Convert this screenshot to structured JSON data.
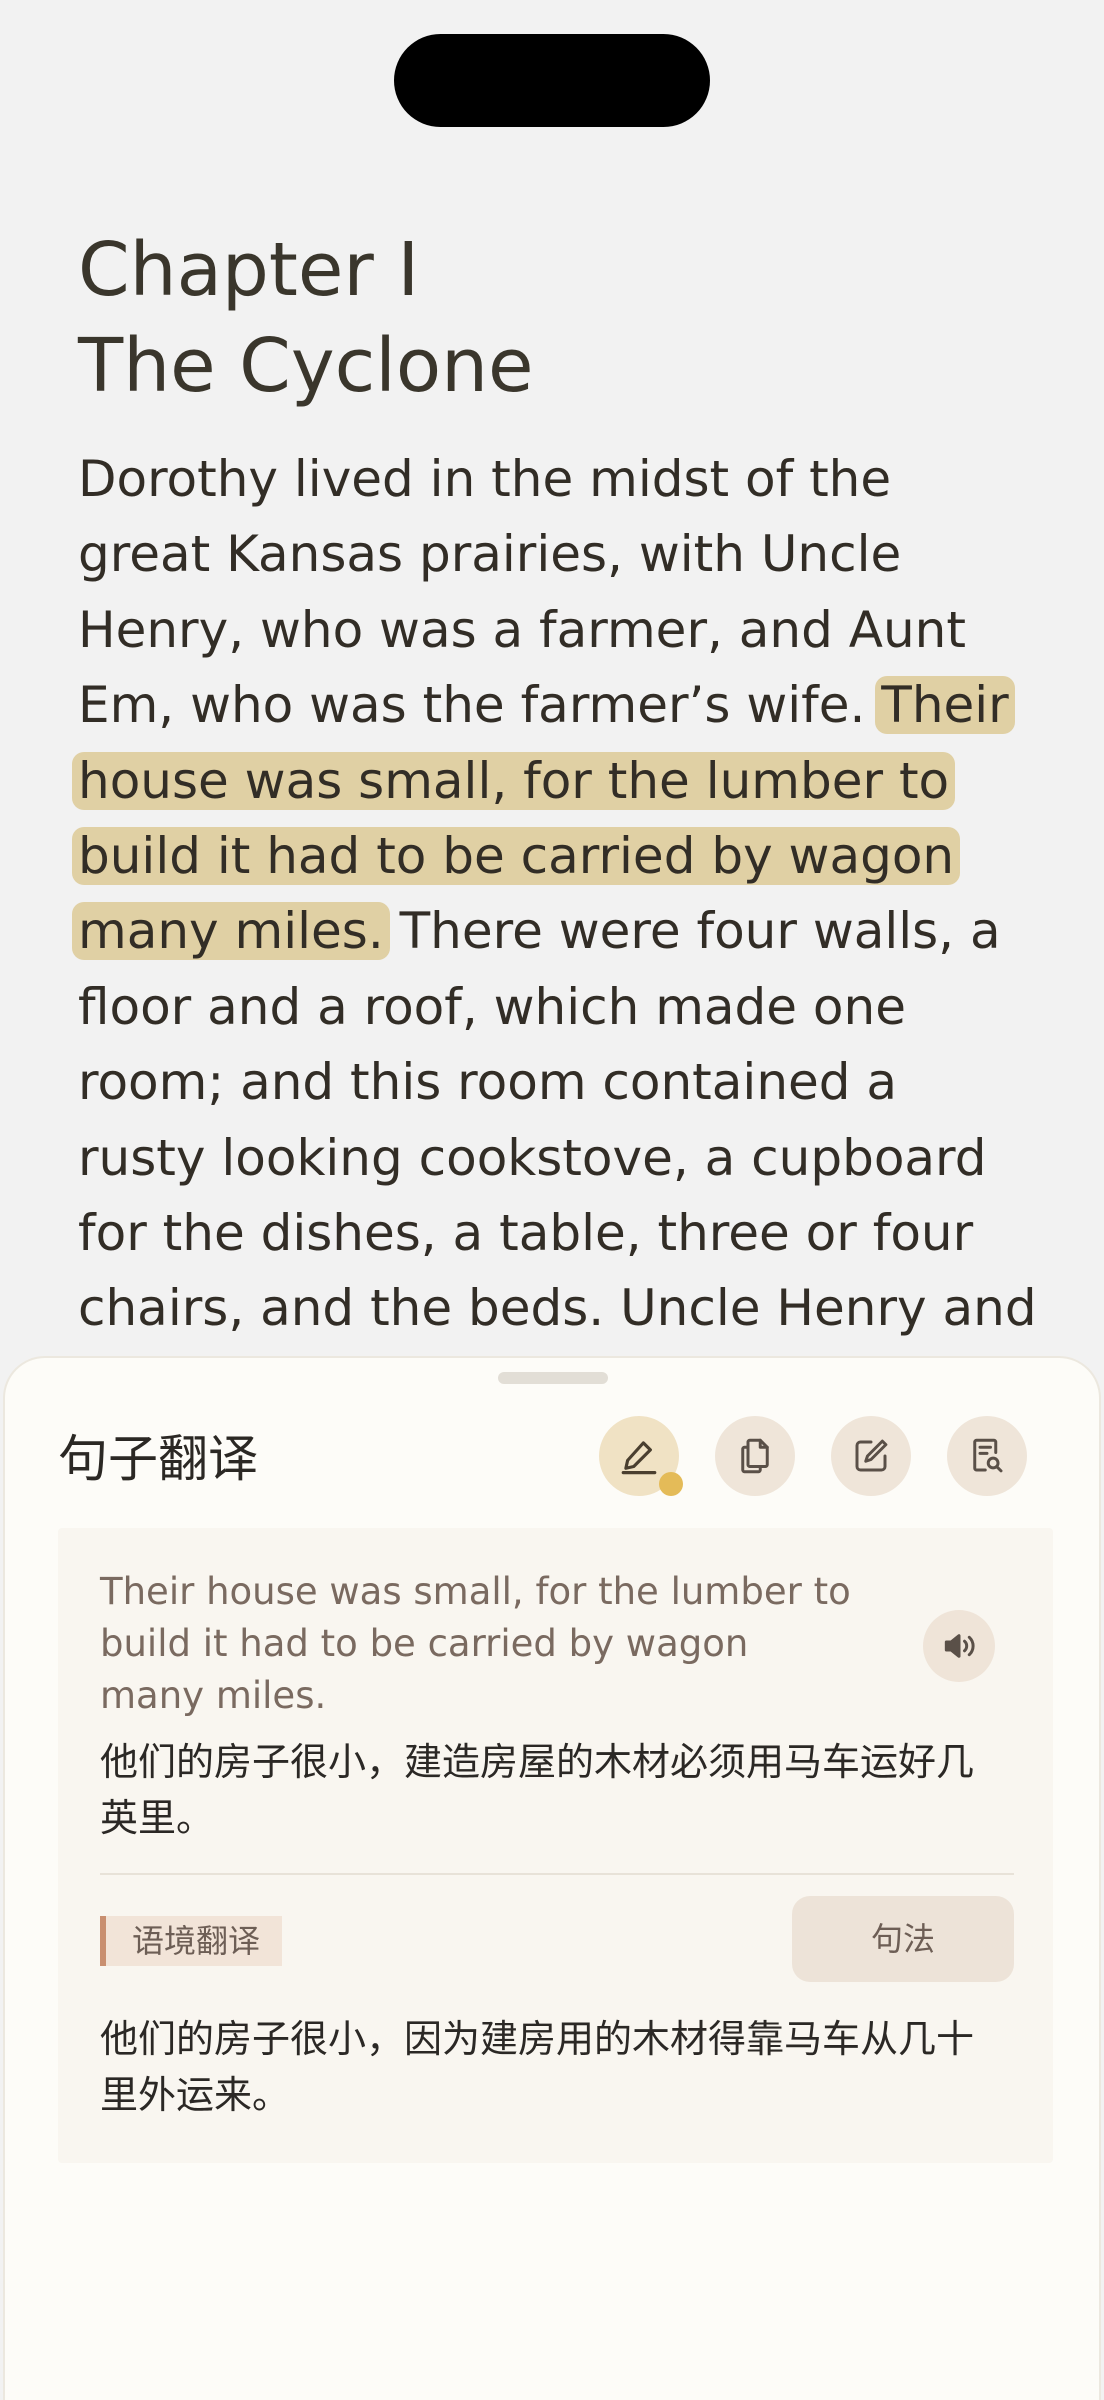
{
  "chapter": {
    "title_line1": "Chapter I",
    "title_line2": "The Cyclone",
    "body_before": "Dorothy lived in the midst of the great Kansas prairies, with Uncle Henry, who was a farmer, and Aunt Em, who was the farmer’s wife. ",
    "body_highlight": "Their house was small, for the lumber to build it had to be carried by wagon many miles.",
    "body_after": " There were four walls, a floor and a roof, which made one room; and this room contained a rusty looking cookstove, a cupboard for the dishes, a table, three or four chairs, and the beds. Uncle Henry and Aunt"
  },
  "sheet": {
    "title": "句子翻译",
    "toolbar": {
      "icons": [
        "highlighter-icon",
        "copy-icon",
        "edit-icon",
        "search-document-icon"
      ],
      "active_icon": "highlighter-icon",
      "active_dot_color": "#e4bb58"
    },
    "source_text": "Their house was small, for the lumber to build it had to be carried by wagon many miles.",
    "translation": "他们的房子很小，建造房屋的木材必须用马车运好几英里。",
    "context_tag": "语境翻译",
    "syntax_button": "句法",
    "context_translation": "他们的房子很小，因为建房用的木材得靠马车从几十里外运来。"
  },
  "colors": {
    "highlight": "#e0d0a4",
    "accent": "#c98f70",
    "sheet_bg": "#fdfcf8"
  }
}
